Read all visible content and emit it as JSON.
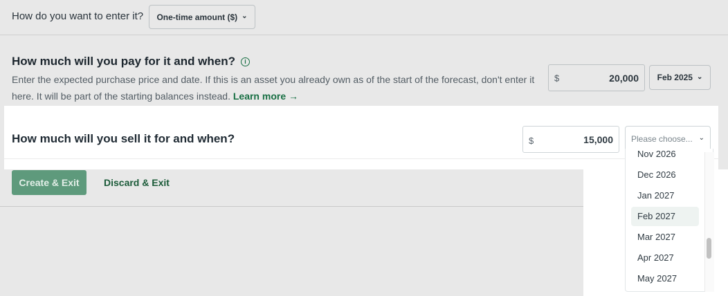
{
  "entry_method": {
    "question": "How do you want to enter it?",
    "selected": "One-time amount ($)"
  },
  "purchase": {
    "question": "How much will you pay for it and when?",
    "description": "Enter the expected purchase price and date. If this is an asset you already own as of the start of the forecast, don't enter it here. It will be part of the starting balances instead.",
    "learn_more": "Learn more →",
    "currency": "$",
    "amount": "20,000",
    "date": "Feb 2025"
  },
  "sale": {
    "question": "How much will you sell it for and when?",
    "currency": "$",
    "amount": "15,000",
    "date_placeholder": "Please choose..."
  },
  "actions": {
    "create_label": "Create & Exit",
    "discard_label": "Discard & Exit"
  },
  "date_dropdown": {
    "options": [
      "Nov 2026",
      "Dec 2026",
      "Jan 2027",
      "Feb 2027",
      "Mar 2027",
      "Apr 2027",
      "May 2027"
    ],
    "highlighted": "Feb 2027"
  },
  "icons": {
    "info": "info-icon",
    "chevron": "chevron-down-icon",
    "arrow": "arrow-right-icon"
  }
}
